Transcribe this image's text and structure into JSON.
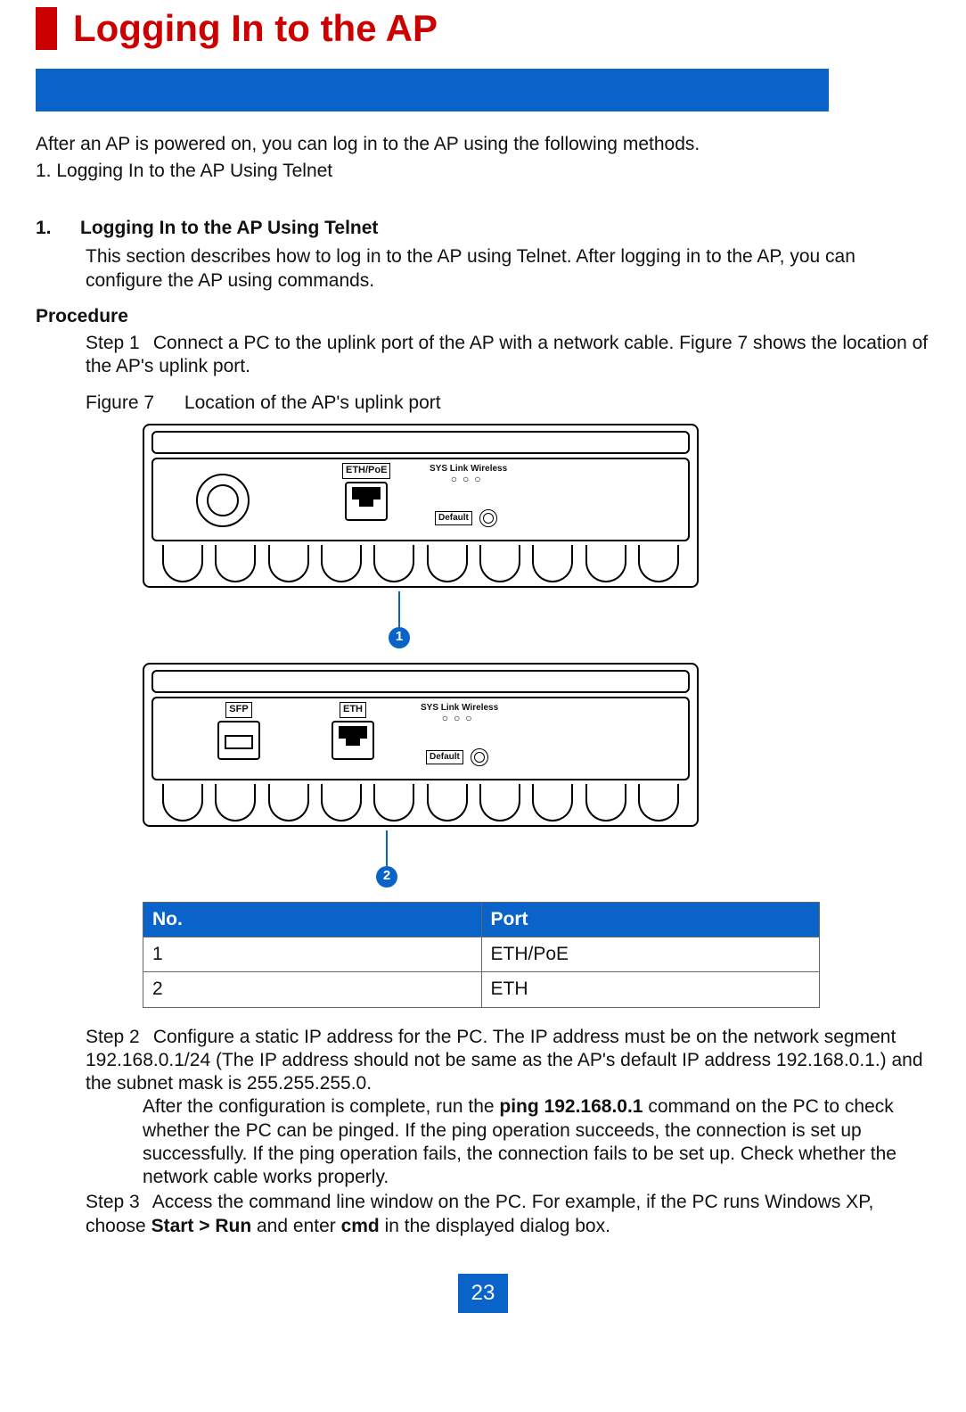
{
  "title": "Logging In to the AP",
  "intro_line1": "After an AP is powered on, you can log in to the AP using the following methods.",
  "intro_line2": "1. Logging In to the AP Using Telnet",
  "section": {
    "num": "1.",
    "heading": "Logging In to the AP Using Telnet",
    "desc": "This section describes how to log in to the AP using Telnet. After logging in to the AP, you can configure the AP using commands."
  },
  "procedure_label": "Procedure",
  "step1": {
    "label": "Step 1",
    "text": "Connect a PC to the uplink port of the AP with a network cable. Figure 7 shows the location of the AP's uplink port."
  },
  "figure": {
    "label": "Figure 7",
    "caption": "Location of the AP's uplink port"
  },
  "device1": {
    "port_label": "ETH/PoE",
    "leds_line": "SYS  Link  Wireless",
    "default_btn": "Default"
  },
  "device2": {
    "sfp_label": "SFP",
    "eth_label": "ETH",
    "leds_line": "SYS Link  Wireless",
    "default_btn": "Default"
  },
  "callouts": {
    "one": "1",
    "two": "2"
  },
  "table": {
    "h1": "No.",
    "h2": "Port",
    "rows": [
      {
        "no": "1",
        "port": "ETH/PoE"
      },
      {
        "no": "2",
        "port": "ETH"
      }
    ]
  },
  "step2": {
    "label": "Step 2",
    "p1": "Configure a static IP address for the PC. The IP address must be on the network segment 192.168.0.1/24 (The IP address should not be same as the AP's default IP address 192.168.0.1.) and the subnet mask is 255.255.255.0.",
    "p2a": "After the configuration is complete, run the ",
    "p2_cmd": "ping 192.168.0.1",
    "p2b": " command on the PC to check whether the PC can be pinged. If the ping operation succeeds, the connection is set up successfully. If the ping operation fails, the connection fails to be set up. Check whether the network cable works properly."
  },
  "step3": {
    "label": "Step 3",
    "a": "Access the command line window on the PC. For example, if the PC runs Windows XP, choose ",
    "b_bold": "Start > Run",
    "c": " and enter ",
    "d_bold": "cmd",
    "e": " in the displayed dialog box."
  },
  "page_number": "23"
}
